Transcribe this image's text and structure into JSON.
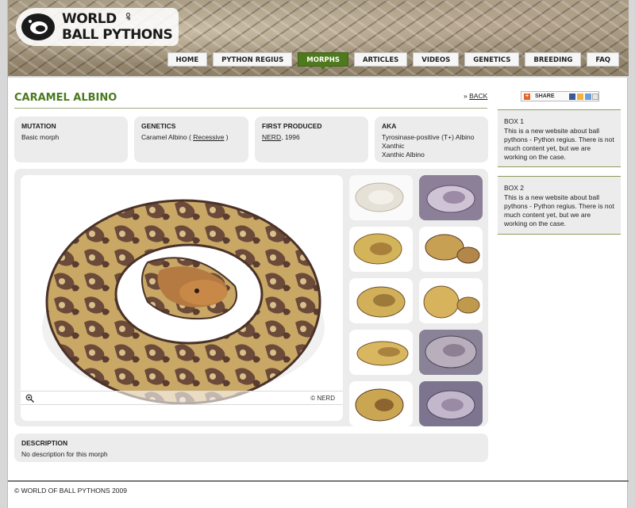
{
  "header": {
    "logo_world": "WORLD",
    "logo_of": "OF",
    "logo_bp": "BALL PYTHONS"
  },
  "nav": [
    {
      "label": "HOME",
      "active": false
    },
    {
      "label": "PYTHON REGIUS",
      "active": false
    },
    {
      "label": "MORPHS",
      "active": true
    },
    {
      "label": "ARTICLES",
      "active": false
    },
    {
      "label": "VIDEOS",
      "active": false
    },
    {
      "label": "GENETICS",
      "active": false
    },
    {
      "label": "BREEDING",
      "active": false
    },
    {
      "label": "FAQ",
      "active": false
    }
  ],
  "page": {
    "title": "CARAMEL ALBINO",
    "back_arrow": "»",
    "back_label": "BACK"
  },
  "info": {
    "mutation": {
      "label": "MUTATION",
      "value": "Basic morph"
    },
    "genetics": {
      "label": "GENETICS",
      "value_prefix": "Caramel Albino ( ",
      "value_link": "Recessive",
      "value_suffix": " )"
    },
    "first_produced": {
      "label": "FIRST PRODUCED",
      "value_link": "NERD",
      "value_suffix": ", 1996"
    },
    "aka": {
      "label": "AKA",
      "lines": [
        "Tyrosinase-positive (T+) Albino",
        "Xanthic",
        "Xanthic Albino"
      ]
    }
  },
  "gallery": {
    "credit": "© NERD",
    "thumbs": [
      {
        "tone": "pale"
      },
      {
        "tone": "purple"
      },
      {
        "tone": "yellow"
      },
      {
        "tone": "brown"
      },
      {
        "tone": "yellow"
      },
      {
        "tone": "yellow"
      },
      {
        "tone": "yellow"
      },
      {
        "tone": "purple"
      },
      {
        "tone": "yellow"
      },
      {
        "tone": "purple"
      }
    ]
  },
  "description": {
    "label": "DESCRIPTION",
    "text": "No description for this morph"
  },
  "footer": {
    "text": "© WORLD OF BALL PYTHONS 2009"
  },
  "sidebar": {
    "share_label": "SHARE",
    "boxes": [
      {
        "title": "BOX 1",
        "text": "This is a new website about ball pythons - Python regius. There is not much content yet, but we are working on the case."
      },
      {
        "title": "BOX 2",
        "text": "This is a new website about ball pythons - Python regius. There is not much content yet, but we are working on the case."
      }
    ]
  },
  "colors": {
    "accent_green": "#4a7a1e",
    "nav_active": "#4e7a1d",
    "panel_gray": "#ececec"
  }
}
